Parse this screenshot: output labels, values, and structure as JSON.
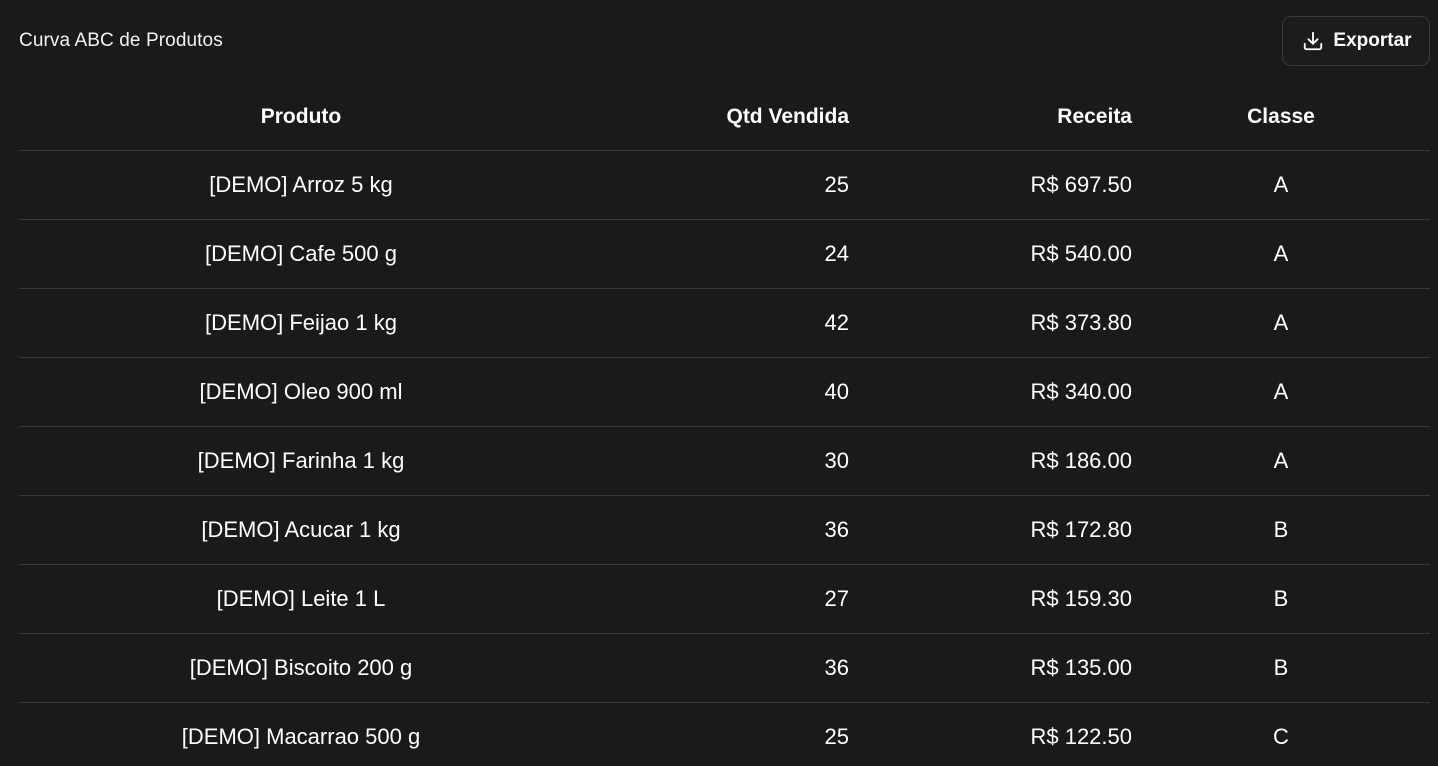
{
  "header": {
    "title": "Curva ABC de Produtos",
    "export_label": "Exportar",
    "export_icon": "download-icon"
  },
  "table": {
    "columns": [
      "Produto",
      "Qtd Vendida",
      "Receita",
      "Classe"
    ],
    "rows": [
      {
        "produto": "[DEMO] Arroz 5 kg",
        "qtd": "25",
        "receita": "R$ 697.50",
        "classe": "A"
      },
      {
        "produto": "[DEMO] Cafe 500 g",
        "qtd": "24",
        "receita": "R$ 540.00",
        "classe": "A"
      },
      {
        "produto": "[DEMO] Feijao 1 kg",
        "qtd": "42",
        "receita": "R$ 373.80",
        "classe": "A"
      },
      {
        "produto": "[DEMO] Oleo 900 ml",
        "qtd": "40",
        "receita": "R$ 340.00",
        "classe": "A"
      },
      {
        "produto": "[DEMO] Farinha 1 kg",
        "qtd": "30",
        "receita": "R$ 186.00",
        "classe": "A"
      },
      {
        "produto": "[DEMO] Acucar 1 kg",
        "qtd": "36",
        "receita": "R$ 172.80",
        "classe": "B"
      },
      {
        "produto": "[DEMO] Leite 1 L",
        "qtd": "27",
        "receita": "R$ 159.30",
        "classe": "B"
      },
      {
        "produto": "[DEMO] Biscoito 200 g",
        "qtd": "36",
        "receita": "R$ 135.00",
        "classe": "B"
      },
      {
        "produto": "[DEMO] Macarrao 500 g",
        "qtd": "25",
        "receita": "R$ 122.50",
        "classe": "C"
      }
    ]
  },
  "colors": {
    "background": "#1a1a1a",
    "text": "#ffffff",
    "divider": "#383838",
    "button_border": "#3a3a3a"
  }
}
